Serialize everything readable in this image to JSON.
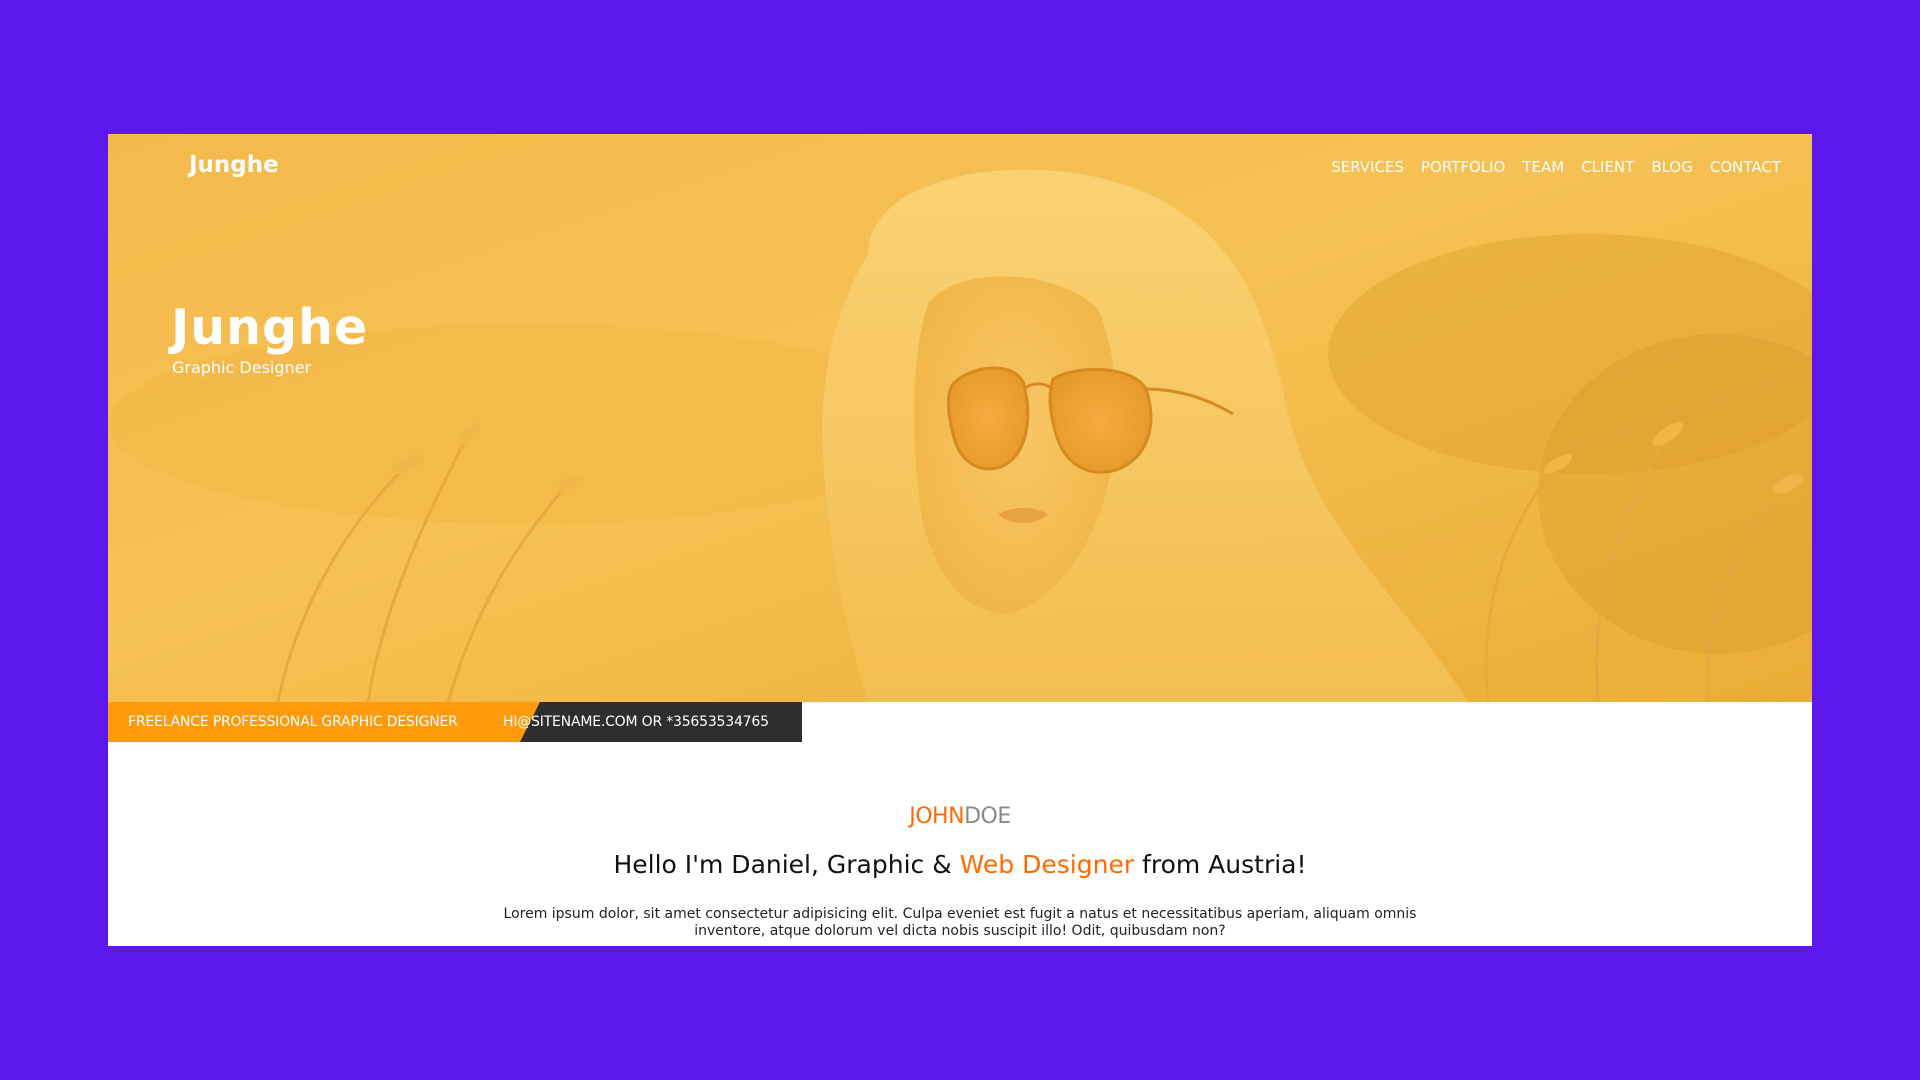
{
  "nav": {
    "logo": "Junghe",
    "items": [
      "SERVICES",
      "PORTFOLIO",
      "TEAM",
      "CLIENT",
      "BLOG",
      "CONTACT"
    ]
  },
  "hero": {
    "title": "Junghe",
    "subtitle": "Graphic Designer"
  },
  "info_bar": {
    "left_text": "FREELANCE PROFESSIONAL GRAPHIC DESIGNER",
    "right_text": "HI@SITENAME.COM OR *35653534765"
  },
  "about": {
    "brand_first": "JOHN",
    "brand_last": "DOE",
    "headline_prefix": "Hello I'm Daniel, Graphic & ",
    "headline_accent": "Web Designer",
    "headline_suffix": " from Austria!",
    "paragraph_line1": "Lorem ipsum dolor, sit amet consectetur adipisicing elit. Culpa eveniet est fugit a natus et necessitatibus aperiam, aliquam omnis",
    "paragraph_line2": "inventore, atque dolorum vel dicta nobis suscipit illo! Odit, quibusdam non?"
  },
  "colors": {
    "background": "#5b17ec",
    "hero_overlay": "#f5bf4a",
    "accent": "#ff6b00",
    "info_left": "#ff9b0a",
    "info_right": "#2e2e2e"
  },
  "icons": {
    "hero_image": "woman-with-sunglasses-photo"
  }
}
